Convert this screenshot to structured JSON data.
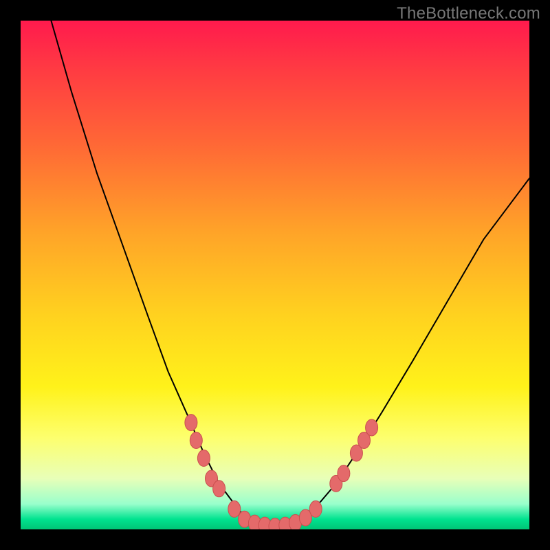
{
  "watermark": "TheBottleneck.com",
  "colors": {
    "curve_stroke": "#000000",
    "marker_fill": "#e46a6a",
    "marker_stroke": "#c94f4f"
  },
  "chart_data": {
    "type": "line",
    "title": "",
    "xlabel": "",
    "ylabel": "",
    "xlim": [
      0,
      100
    ],
    "ylim": [
      0,
      100
    ],
    "grid": false,
    "curve": [
      {
        "x": 6,
        "y": 100
      },
      {
        "x": 10,
        "y": 86
      },
      {
        "x": 15,
        "y": 70
      },
      {
        "x": 20,
        "y": 56
      },
      {
        "x": 25,
        "y": 42
      },
      {
        "x": 29,
        "y": 31
      },
      {
        "x": 33,
        "y": 22
      },
      {
        "x": 36,
        "y": 15
      },
      {
        "x": 39,
        "y": 9
      },
      {
        "x": 42,
        "y": 5
      },
      {
        "x": 44,
        "y": 2.5
      },
      {
        "x": 47,
        "y": 1
      },
      {
        "x": 50,
        "y": 0.5
      },
      {
        "x": 53,
        "y": 1
      },
      {
        "x": 56,
        "y": 2.5
      },
      {
        "x": 59,
        "y": 5.5
      },
      {
        "x": 62,
        "y": 9
      },
      {
        "x": 66,
        "y": 15
      },
      {
        "x": 71,
        "y": 23
      },
      {
        "x": 77,
        "y": 33
      },
      {
        "x": 84,
        "y": 45
      },
      {
        "x": 91,
        "y": 57
      },
      {
        "x": 100,
        "y": 69
      }
    ],
    "markers": [
      {
        "x": 33.5,
        "y": 21
      },
      {
        "x": 34.5,
        "y": 17.5
      },
      {
        "x": 36,
        "y": 14
      },
      {
        "x": 37.5,
        "y": 10
      },
      {
        "x": 39,
        "y": 8
      },
      {
        "x": 42,
        "y": 4
      },
      {
        "x": 44,
        "y": 2
      },
      {
        "x": 46,
        "y": 1.2
      },
      {
        "x": 48,
        "y": 0.8
      },
      {
        "x": 50,
        "y": 0.6
      },
      {
        "x": 52,
        "y": 0.8
      },
      {
        "x": 54,
        "y": 1.3
      },
      {
        "x": 56,
        "y": 2.3
      },
      {
        "x": 58,
        "y": 4
      },
      {
        "x": 62,
        "y": 9
      },
      {
        "x": 63.5,
        "y": 11
      },
      {
        "x": 66,
        "y": 15
      },
      {
        "x": 67.5,
        "y": 17.5
      },
      {
        "x": 69,
        "y": 20
      }
    ]
  }
}
